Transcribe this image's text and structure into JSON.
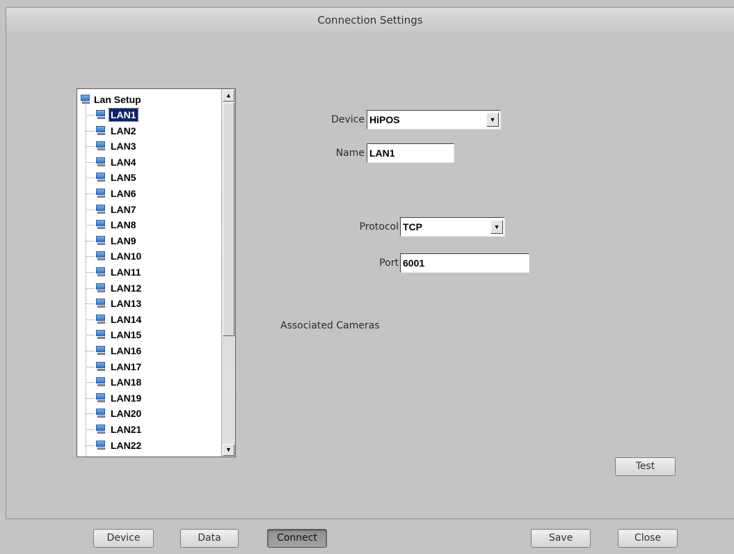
{
  "window": {
    "title": "Connection Settings"
  },
  "tree": {
    "root_label": "Lan Setup",
    "selected": "LAN1",
    "items": [
      "LAN1",
      "LAN2",
      "LAN3",
      "LAN4",
      "LAN5",
      "LAN6",
      "LAN7",
      "LAN8",
      "LAN9",
      "LAN10",
      "LAN11",
      "LAN12",
      "LAN13",
      "LAN14",
      "LAN15",
      "LAN16",
      "LAN17",
      "LAN18",
      "LAN19",
      "LAN20",
      "LAN21",
      "LAN22"
    ]
  },
  "form": {
    "device_label": "Device",
    "device_value": "HiPOS",
    "name_label": "Name",
    "name_value": "LAN1",
    "protocol_label": "Protocol",
    "protocol_value": "TCP",
    "port_label": "Port",
    "port_value": "6001",
    "associated_cameras_label": "Associated Cameras"
  },
  "buttons": {
    "test": "Test",
    "device": "Device",
    "data": "Data",
    "connect": "Connect",
    "save": "Save",
    "close": "Close"
  },
  "icons": {
    "tree_node": "network-computer-icon",
    "scroll_up": "arrow-up-icon",
    "scroll_down": "arrow-down-icon",
    "dropdown": "arrow-down-icon"
  },
  "colors": {
    "background": "#c4c4c4",
    "selection": "#0a246a",
    "pressed_button": "#9a9a9a"
  }
}
